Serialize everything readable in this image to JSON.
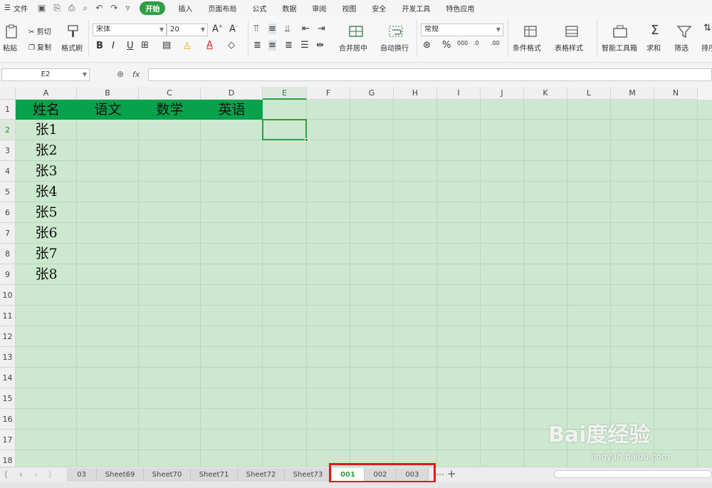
{
  "menubar": {
    "file": "文件",
    "tabs": [
      "开始",
      "插入",
      "页面布局",
      "公式",
      "数据",
      "审阅",
      "视图",
      "安全",
      "开发工具",
      "特色应用"
    ],
    "active_tab": "开始"
  },
  "ribbon": {
    "paste": "粘贴",
    "cut": "剪切",
    "copy": "复制",
    "format_painter": "格式刷",
    "font_name": "宋体",
    "font_size": "20",
    "merge_center": "合并居中",
    "wrap_text": "自动换行",
    "number_format": "常规",
    "conditional_format": "条件格式",
    "table_style": "表格样式",
    "smart_toolbox": "智能工具箱",
    "sum": "求和",
    "filter": "筛选",
    "sort": "排序"
  },
  "formula_bar": {
    "name_box": "E2",
    "fx": "fx",
    "value": ""
  },
  "columns": [
    "A",
    "B",
    "C",
    "D",
    "E",
    "F",
    "G",
    "H",
    "I",
    "J",
    "K",
    "L",
    "M",
    "N"
  ],
  "rows": [
    "1",
    "2",
    "3",
    "4",
    "5",
    "6",
    "7",
    "8",
    "9",
    "10",
    "11",
    "12",
    "13",
    "14",
    "15",
    "16",
    "17",
    "18"
  ],
  "selected_cell": "E2",
  "table": {
    "headers": [
      "姓名",
      "语文",
      "数学",
      "英语"
    ],
    "names": [
      "张1",
      "张2",
      "张3",
      "张4",
      "张5",
      "张6",
      "张7",
      "张8"
    ]
  },
  "sheets": [
    "03",
    "Sheet69",
    "Sheet70",
    "Sheet71",
    "Sheet72",
    "Sheet73",
    "001",
    "002",
    "003"
  ],
  "active_sheet": "001",
  "watermark": {
    "logo": "Bai度经验",
    "url": "jingyan.baidu.com"
  },
  "colors": {
    "accent": "#2f9e44",
    "header_fill": "#07a24b",
    "grid_bg": "#cce8cf",
    "highlight": "#e01818"
  }
}
